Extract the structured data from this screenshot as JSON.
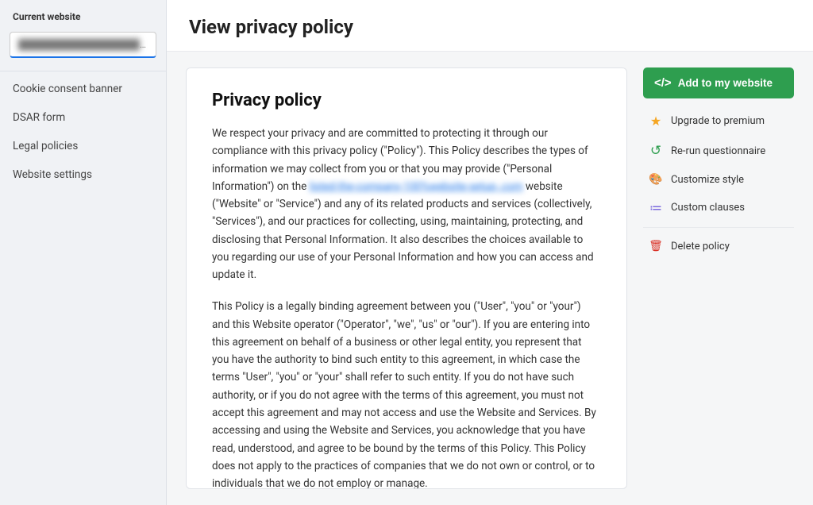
{
  "sidebar": {
    "section_label": "Current website",
    "website_placeholder": "████████████████████",
    "nav_items": [
      {
        "label": "Cookie consent banner",
        "name": "cookie-consent-banner"
      },
      {
        "label": "DSAR form",
        "name": "dsar-form"
      },
      {
        "label": "Legal policies",
        "name": "legal-policies"
      },
      {
        "label": "Website settings",
        "name": "website-settings"
      }
    ]
  },
  "main": {
    "page_title": "View privacy policy",
    "policy": {
      "title": "Privacy policy",
      "paragraph1": "We respect your privacy and are committed to protecting it through our compliance with this privacy policy (\"Policy\"). This Policy describes the types of information we may collect from you or that you may provide (\"Personal Information\") on the ",
      "link_text": "listed-the-company-100%website-setup-.com",
      "paragraph1_cont": " website (\"Website\" or \"Service\") and any of its related products and services (collectively, \"Services\"), and our practices for collecting, using, maintaining, protecting, and disclosing that Personal Information. It also describes the choices available to you regarding our use of your Personal Information and how you can access and update it.",
      "paragraph2": "This Policy is a legally binding agreement between you (\"User\", \"you\" or \"your\") and this Website operator (\"Operator\", \"we\", \"us\" or \"our\"). If you are entering into this agreement on behalf of a business or other legal entity, you represent that you have the authority to bind such entity to this agreement, in which case the terms \"User\", \"you\" or \"your\" shall refer to such entity. If you do not have such authority, or if you do not agree with the terms of this agreement, you must not accept this agreement and may not access and use the Website and Services. By accessing and using the Website and Services, you acknowledge that you have read, understood, and agree to be bound by the terms of this Policy. This Policy does not apply to the practices of companies that we do not own or control, or to individuals that we do not employ or manage."
    }
  },
  "right_sidebar": {
    "add_btn_label": "Add to my website",
    "actions": [
      {
        "label": "Upgrade to premium",
        "icon": "★",
        "icon_class": "icon-star",
        "name": "upgrade-to-premium"
      },
      {
        "label": "Re-run questionnaire",
        "icon": "↺",
        "icon_class": "icon-refresh",
        "name": "rerun-questionnaire"
      },
      {
        "label": "Customize style",
        "icon": "🎨",
        "icon_class": "icon-paint",
        "name": "customize-style"
      },
      {
        "label": "Custom clauses",
        "icon": "≔",
        "icon_class": "icon-list",
        "name": "custom-clauses"
      }
    ],
    "delete_label": "Delete policy",
    "delete_icon": "🗑",
    "delete_icon_class": "icon-trash"
  }
}
